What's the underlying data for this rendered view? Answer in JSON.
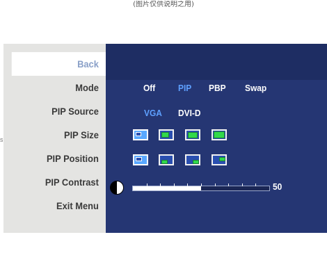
{
  "caption": "(图片仅供说明之用)",
  "side_mark": "s",
  "menu": {
    "items": [
      {
        "label": "Back",
        "selected": true
      },
      {
        "label": "Mode",
        "selected": false
      },
      {
        "label": "PIP Source",
        "selected": false
      },
      {
        "label": "PIP Size",
        "selected": false
      },
      {
        "label": "PIP Position",
        "selected": false
      },
      {
        "label": "PIP Contrast",
        "selected": false
      },
      {
        "label": "Exit Menu",
        "selected": false
      }
    ]
  },
  "mode": {
    "options": [
      "Off",
      "PIP",
      "PBP",
      "Swap"
    ],
    "selected": "PIP"
  },
  "pip_source": {
    "options": [
      "VGA",
      "DVI-D"
    ],
    "selected": "VGA"
  },
  "pip_size": {
    "count": 4,
    "selected_index": 0
  },
  "pip_position": {
    "count": 4,
    "selected_index": 0
  },
  "pip_contrast": {
    "value": "50",
    "max": 100
  },
  "colors": {
    "panel": "#253673",
    "menu_bg": "#e4e4e2",
    "selected_text": "#5ea0ff",
    "pip_window": "#31d94a"
  }
}
